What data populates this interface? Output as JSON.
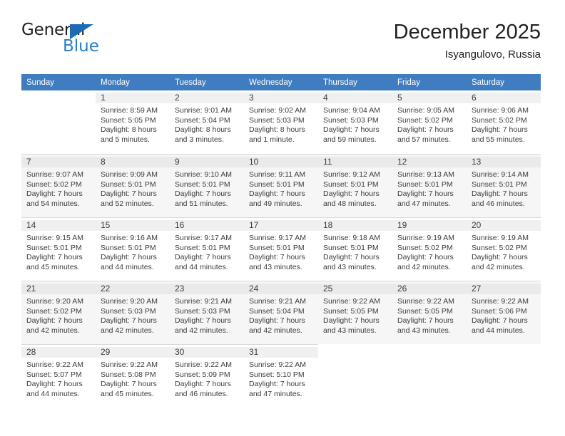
{
  "brand": {
    "name_top": "General",
    "name_bottom": "Blue",
    "triangle_icon": "triangle-icon",
    "color_dark": "#231f20",
    "color_blue": "#2a7fc9"
  },
  "header": {
    "month_title": "December 2025",
    "location": "Isyangulovo, Russia"
  },
  "theme": {
    "header_bg": "#3f7cc0",
    "header_text": "#ffffff",
    "row_alt_bg": "#f6f6f6",
    "daynum_bg": "#f0f0f0",
    "grid_line": "#d9d9d9"
  },
  "weekday_headers": [
    "Sunday",
    "Monday",
    "Tuesday",
    "Wednesday",
    "Thursday",
    "Friday",
    "Saturday"
  ],
  "weeks": [
    {
      "alt": false,
      "days": [
        {
          "day": "",
          "sunrise": "",
          "sunset": "",
          "daylight_line1": "",
          "daylight_line2": ""
        },
        {
          "day": "1",
          "sunrise": "Sunrise: 8:59 AM",
          "sunset": "Sunset: 5:05 PM",
          "daylight_line1": "Daylight: 8 hours",
          "daylight_line2": "and 5 minutes."
        },
        {
          "day": "2",
          "sunrise": "Sunrise: 9:01 AM",
          "sunset": "Sunset: 5:04 PM",
          "daylight_line1": "Daylight: 8 hours",
          "daylight_line2": "and 3 minutes."
        },
        {
          "day": "3",
          "sunrise": "Sunrise: 9:02 AM",
          "sunset": "Sunset: 5:03 PM",
          "daylight_line1": "Daylight: 8 hours",
          "daylight_line2": "and 1 minute."
        },
        {
          "day": "4",
          "sunrise": "Sunrise: 9:04 AM",
          "sunset": "Sunset: 5:03 PM",
          "daylight_line1": "Daylight: 7 hours",
          "daylight_line2": "and 59 minutes."
        },
        {
          "day": "5",
          "sunrise": "Sunrise: 9:05 AM",
          "sunset": "Sunset: 5:02 PM",
          "daylight_line1": "Daylight: 7 hours",
          "daylight_line2": "and 57 minutes."
        },
        {
          "day": "6",
          "sunrise": "Sunrise: 9:06 AM",
          "sunset": "Sunset: 5:02 PM",
          "daylight_line1": "Daylight: 7 hours",
          "daylight_line2": "and 55 minutes."
        }
      ]
    },
    {
      "alt": true,
      "days": [
        {
          "day": "7",
          "sunrise": "Sunrise: 9:07 AM",
          "sunset": "Sunset: 5:02 PM",
          "daylight_line1": "Daylight: 7 hours",
          "daylight_line2": "and 54 minutes."
        },
        {
          "day": "8",
          "sunrise": "Sunrise: 9:09 AM",
          "sunset": "Sunset: 5:01 PM",
          "daylight_line1": "Daylight: 7 hours",
          "daylight_line2": "and 52 minutes."
        },
        {
          "day": "9",
          "sunrise": "Sunrise: 9:10 AM",
          "sunset": "Sunset: 5:01 PM",
          "daylight_line1": "Daylight: 7 hours",
          "daylight_line2": "and 51 minutes."
        },
        {
          "day": "10",
          "sunrise": "Sunrise: 9:11 AM",
          "sunset": "Sunset: 5:01 PM",
          "daylight_line1": "Daylight: 7 hours",
          "daylight_line2": "and 49 minutes."
        },
        {
          "day": "11",
          "sunrise": "Sunrise: 9:12 AM",
          "sunset": "Sunset: 5:01 PM",
          "daylight_line1": "Daylight: 7 hours",
          "daylight_line2": "and 48 minutes."
        },
        {
          "day": "12",
          "sunrise": "Sunrise: 9:13 AM",
          "sunset": "Sunset: 5:01 PM",
          "daylight_line1": "Daylight: 7 hours",
          "daylight_line2": "and 47 minutes."
        },
        {
          "day": "13",
          "sunrise": "Sunrise: 9:14 AM",
          "sunset": "Sunset: 5:01 PM",
          "daylight_line1": "Daylight: 7 hours",
          "daylight_line2": "and 46 minutes."
        }
      ]
    },
    {
      "alt": false,
      "days": [
        {
          "day": "14",
          "sunrise": "Sunrise: 9:15 AM",
          "sunset": "Sunset: 5:01 PM",
          "daylight_line1": "Daylight: 7 hours",
          "daylight_line2": "and 45 minutes."
        },
        {
          "day": "15",
          "sunrise": "Sunrise: 9:16 AM",
          "sunset": "Sunset: 5:01 PM",
          "daylight_line1": "Daylight: 7 hours",
          "daylight_line2": "and 44 minutes."
        },
        {
          "day": "16",
          "sunrise": "Sunrise: 9:17 AM",
          "sunset": "Sunset: 5:01 PM",
          "daylight_line1": "Daylight: 7 hours",
          "daylight_line2": "and 44 minutes."
        },
        {
          "day": "17",
          "sunrise": "Sunrise: 9:17 AM",
          "sunset": "Sunset: 5:01 PM",
          "daylight_line1": "Daylight: 7 hours",
          "daylight_line2": "and 43 minutes."
        },
        {
          "day": "18",
          "sunrise": "Sunrise: 9:18 AM",
          "sunset": "Sunset: 5:01 PM",
          "daylight_line1": "Daylight: 7 hours",
          "daylight_line2": "and 43 minutes."
        },
        {
          "day": "19",
          "sunrise": "Sunrise: 9:19 AM",
          "sunset": "Sunset: 5:02 PM",
          "daylight_line1": "Daylight: 7 hours",
          "daylight_line2": "and 42 minutes."
        },
        {
          "day": "20",
          "sunrise": "Sunrise: 9:19 AM",
          "sunset": "Sunset: 5:02 PM",
          "daylight_line1": "Daylight: 7 hours",
          "daylight_line2": "and 42 minutes."
        }
      ]
    },
    {
      "alt": true,
      "days": [
        {
          "day": "21",
          "sunrise": "Sunrise: 9:20 AM",
          "sunset": "Sunset: 5:02 PM",
          "daylight_line1": "Daylight: 7 hours",
          "daylight_line2": "and 42 minutes."
        },
        {
          "day": "22",
          "sunrise": "Sunrise: 9:20 AM",
          "sunset": "Sunset: 5:03 PM",
          "daylight_line1": "Daylight: 7 hours",
          "daylight_line2": "and 42 minutes."
        },
        {
          "day": "23",
          "sunrise": "Sunrise: 9:21 AM",
          "sunset": "Sunset: 5:03 PM",
          "daylight_line1": "Daylight: 7 hours",
          "daylight_line2": "and 42 minutes."
        },
        {
          "day": "24",
          "sunrise": "Sunrise: 9:21 AM",
          "sunset": "Sunset: 5:04 PM",
          "daylight_line1": "Daylight: 7 hours",
          "daylight_line2": "and 42 minutes."
        },
        {
          "day": "25",
          "sunrise": "Sunrise: 9:22 AM",
          "sunset": "Sunset: 5:05 PM",
          "daylight_line1": "Daylight: 7 hours",
          "daylight_line2": "and 43 minutes."
        },
        {
          "day": "26",
          "sunrise": "Sunrise: 9:22 AM",
          "sunset": "Sunset: 5:05 PM",
          "daylight_line1": "Daylight: 7 hours",
          "daylight_line2": "and 43 minutes."
        },
        {
          "day": "27",
          "sunrise": "Sunrise: 9:22 AM",
          "sunset": "Sunset: 5:06 PM",
          "daylight_line1": "Daylight: 7 hours",
          "daylight_line2": "and 44 minutes."
        }
      ]
    },
    {
      "alt": false,
      "days": [
        {
          "day": "28",
          "sunrise": "Sunrise: 9:22 AM",
          "sunset": "Sunset: 5:07 PM",
          "daylight_line1": "Daylight: 7 hours",
          "daylight_line2": "and 44 minutes."
        },
        {
          "day": "29",
          "sunrise": "Sunrise: 9:22 AM",
          "sunset": "Sunset: 5:08 PM",
          "daylight_line1": "Daylight: 7 hours",
          "daylight_line2": "and 45 minutes."
        },
        {
          "day": "30",
          "sunrise": "Sunrise: 9:22 AM",
          "sunset": "Sunset: 5:09 PM",
          "daylight_line1": "Daylight: 7 hours",
          "daylight_line2": "and 46 minutes."
        },
        {
          "day": "31",
          "sunrise": "Sunrise: 9:22 AM",
          "sunset": "Sunset: 5:10 PM",
          "daylight_line1": "Daylight: 7 hours",
          "daylight_line2": "and 47 minutes."
        },
        {
          "day": "",
          "sunrise": "",
          "sunset": "",
          "daylight_line1": "",
          "daylight_line2": ""
        },
        {
          "day": "",
          "sunrise": "",
          "sunset": "",
          "daylight_line1": "",
          "daylight_line2": ""
        },
        {
          "day": "",
          "sunrise": "",
          "sunset": "",
          "daylight_line1": "",
          "daylight_line2": ""
        }
      ]
    }
  ]
}
